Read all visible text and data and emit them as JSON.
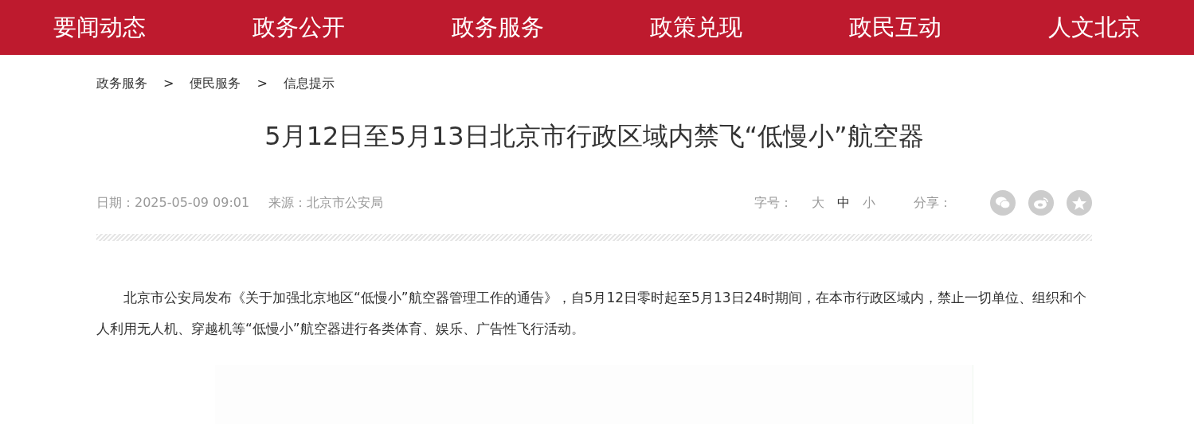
{
  "nav": [
    {
      "label": "要闻动态"
    },
    {
      "label": "政务公开"
    },
    {
      "label": "政务服务"
    },
    {
      "label": "政策兑现"
    },
    {
      "label": "政民互动"
    },
    {
      "label": "人文北京"
    }
  ],
  "breadcrumb": {
    "items": [
      "政务服务",
      "便民服务",
      "信息提示"
    ],
    "separators": [
      ">",
      ">"
    ]
  },
  "article": {
    "title": "5月12日至5月13日北京市行政区域内禁飞“低慢小”航空器",
    "date": "日期：2025-05-09 09:01",
    "source": "来源：北京市公安局",
    "font_size_label": "字号：",
    "font_sizes": [
      {
        "label": "大",
        "selected": false
      },
      {
        "label": "中",
        "selected": true
      },
      {
        "label": "小",
        "selected": false
      }
    ],
    "share_label": "分享：",
    "share_buttons": [
      {
        "kind": "chat"
      },
      {
        "kind": "swirl"
      },
      {
        "kind": "star"
      }
    ],
    "paragraph": "北京市公安局发布《关于加强北京地区“低慢小”航空器管理工作的通告》，自5月12日零时起至5月13日24时期间，在本市行政区域内，禁止一切单位、组织和个人利用无人机、穿越机等“低慢小”航空器进行各类体育、娱乐、广告性飞行活动。"
  }
}
